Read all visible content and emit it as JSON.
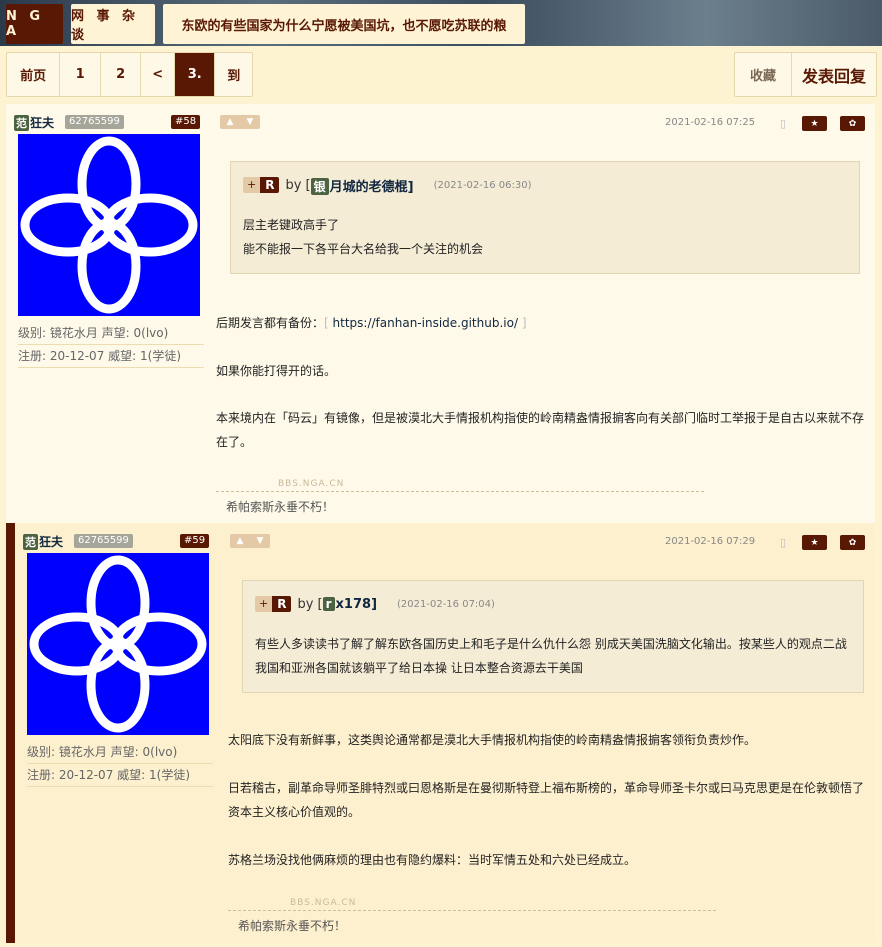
{
  "header": {
    "logo": "N G A",
    "forum": "网 事 杂 谈",
    "topic_title": "东欧的有些国家为什么宁愿被美国坑，也不愿吃苏联的粮"
  },
  "pager": {
    "prev": "前页",
    "p1": "1",
    "p2": "2",
    "back": "<",
    "current": "3.",
    "goto": "到"
  },
  "actions": {
    "favorite": "收藏",
    "reply": "发表回复"
  },
  "posts": [
    {
      "user_tag": "范",
      "username": "狂夫",
      "uid": "62765599",
      "floor": "#58",
      "level": "级别: 镜花水月   声望: 0(lvo)",
      "reg": "注册: 20-12-07 威望: 1(学徒)",
      "time": "2021-02-16 07:25",
      "quote": {
        "plus": "+",
        "r": "R",
        "by": "by [",
        "name_tag": "银",
        "name": "月城的老德棍]",
        "time": "(2021-02-16 06:30)",
        "lines": [
          "层主老键政高手了",
          "能不能报一下各平台大名给我一个关注的机会"
        ]
      },
      "paragraphs": [
        {
          "pre": "后期发言都有备份：",
          "link": "https://fanhan-inside.github.io/"
        },
        {
          "text": "如果你能打得开的话。"
        },
        {
          "text": "本来境内在「码云」有镜像，但是被漠北大手情报机构指使的岭南精盎情报掮客向有关部门临时工举报于是自古以来就不存在了。"
        }
      ],
      "watermark": "BBS.NGA.CN",
      "signature": "希帕索斯永垂不朽！"
    },
    {
      "user_tag": "范",
      "username": "狂夫",
      "uid": "62765599",
      "floor": "#59",
      "level": "级别: 镜花水月   声望: 0(lvo)",
      "reg": "注册: 20-12-07 威望: 1(学徒)",
      "time": "2021-02-16 07:29",
      "quote": {
        "plus": "+",
        "r": "R",
        "by": "by [",
        "name_tag": "r",
        "name": "x178]",
        "time": "(2021-02-16 07:04)",
        "lines": [
          "有些人多读读书了解了解东欧各国历史上和毛子是什么仇什么怨 别成天美国洗脑文化输出。按某些人的观点二战我国和亚洲各国就该躺平了给日本操 让日本整合资源去干美国"
        ]
      },
      "paragraphs": [
        {
          "text": "太阳底下没有新鲜事，这类舆论通常都是漠北大手情报机构指使的岭南精盎情报掮客领衔负责炒作。"
        },
        {
          "text": "日若稽古，副革命导师圣腓特烈或曰恩格斯是在曼彻斯特登上福布斯榜的，革命导师圣卡尔或曰马克思更是在伦敦顿悟了资本主义核心价值观的。"
        },
        {
          "text": "苏格兰场没找他俩麻烦的理由也有隐约爆料：当时军情五处和六处已经成立。"
        }
      ],
      "watermark": "BBS.NGA.CN",
      "signature": "希帕索斯永垂不朽！"
    }
  ],
  "colors": {
    "accent": "#591804",
    "page_bg": "#fef3d1",
    "avatar_bg": "#0000ff"
  }
}
